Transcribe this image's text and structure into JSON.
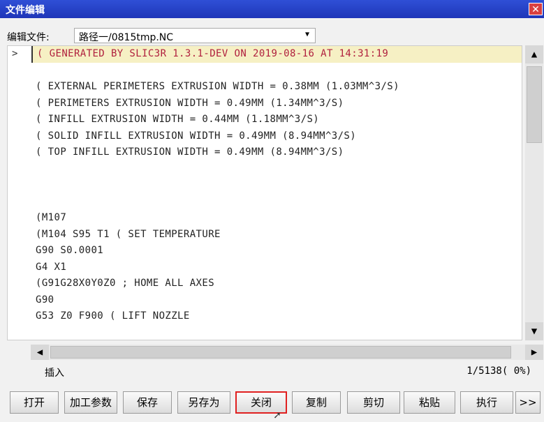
{
  "window": {
    "title": "文件编辑",
    "close_label": "✕"
  },
  "file": {
    "label": "编辑文件:",
    "path": "路径一/0815tmp.NC",
    "dropdown_icon": "chevron-down-icon"
  },
  "editor": {
    "cursor_marker": ">",
    "lines": [
      "( GENERATED BY SLIC3R 1.3.1-DEV ON 2019-08-16 AT 14:31:19",
      "",
      "( EXTERNAL PERIMETERS EXTRUSION WIDTH = 0.38MM (1.03MM^3/S)",
      "( PERIMETERS EXTRUSION WIDTH = 0.49MM (1.34MM^3/S)",
      "( INFILL EXTRUSION WIDTH = 0.44MM (1.18MM^3/S)",
      "( SOLID INFILL EXTRUSION WIDTH = 0.49MM (8.94MM^3/S)",
      "( TOP INFILL EXTRUSION WIDTH = 0.49MM (8.94MM^3/S)",
      "",
      "",
      "",
      "(M107",
      "(M104 S95 T1 ( SET TEMPERATURE",
      "G90 S0.0001",
      "G4 X1",
      "(G91G28X0Y0Z0 ; HOME ALL AXES",
      "G90",
      "G53 Z0 F900 ( LIFT NOZZLE"
    ]
  },
  "scrollbar": {
    "up": "▲",
    "down": "▼",
    "left": "◀",
    "right": "▶"
  },
  "status": {
    "mode": "插入",
    "position": "1/5138( 0%)"
  },
  "toolbar": {
    "open": "打开",
    "params": "加工参数",
    "save": "保存",
    "save_as": "另存为",
    "close": "关闭",
    "copy": "复制",
    "cut": "剪切",
    "paste": "粘贴",
    "run": "执行",
    "more": ">>"
  },
  "colors": {
    "titlebar": "#1f36b8",
    "highlight_bg": "#f6f0c4",
    "highlight_text": "#b0203e",
    "active_border": "#e02020"
  }
}
